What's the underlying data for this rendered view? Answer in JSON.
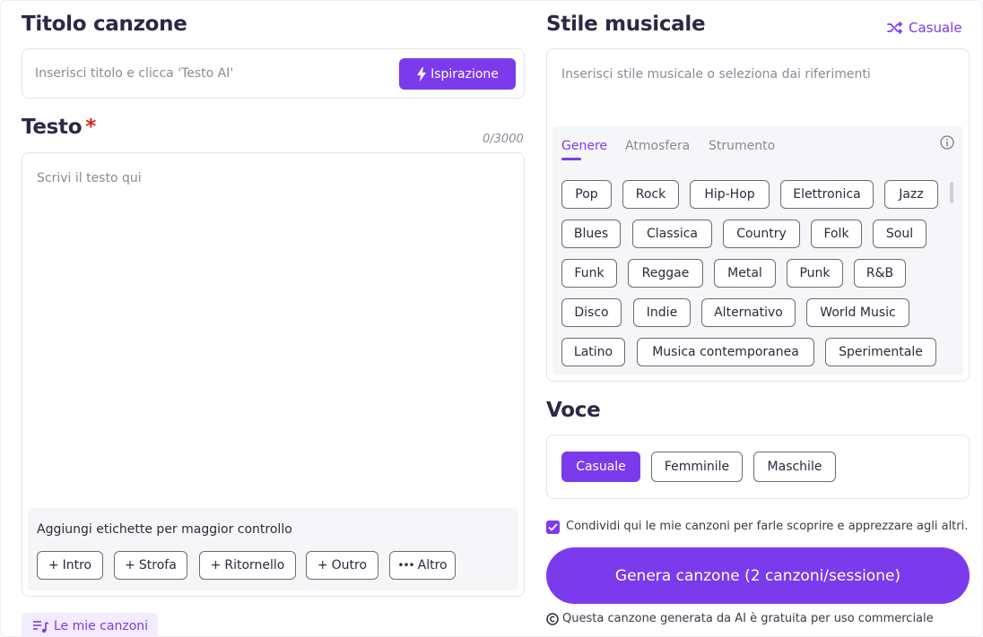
{
  "title_section": {
    "heading": "Titolo canzone",
    "input_placeholder": "Inserisci titolo e clicca 'Testo AI'",
    "inspiration_label": "Ispirazione"
  },
  "lyrics_section": {
    "heading": "Testo",
    "required_mark": "*",
    "counter": "0/3000",
    "textarea_placeholder": "Scrivi il testo qui",
    "tags_hint": "Aggiungi etichette per maggior controllo",
    "tags": [
      {
        "label": "Intro"
      },
      {
        "label": "Strofa"
      },
      {
        "label": "Ritornello"
      },
      {
        "label": "Outro"
      },
      {
        "label": "Altro"
      }
    ]
  },
  "my_songs_label": "Le mie canzoni",
  "style_section": {
    "heading": "Stile musicale",
    "random_label": "Casuale",
    "input_placeholder": "Inserisci stile musicale o seleziona dai riferimenti",
    "tabs": [
      {
        "label": "Genere",
        "active": true
      },
      {
        "label": "Atmosfera",
        "active": false
      },
      {
        "label": "Strumento",
        "active": false
      }
    ],
    "genres": [
      "Pop",
      "Rock",
      "Hip-Hop",
      "Elettronica",
      "Jazz",
      "Blues",
      "Classica",
      "Country",
      "Folk",
      "Soul",
      "Funk",
      "Reggae",
      "Metal",
      "Punk",
      "R&B",
      "Disco",
      "Indie",
      "Alternativo",
      "World Music",
      "Latino",
      "Musica contemporanea",
      "Sperimentale"
    ]
  },
  "voice_section": {
    "heading": "Voce",
    "options": [
      {
        "label": "Casuale",
        "selected": true
      },
      {
        "label": "Femminile",
        "selected": false
      },
      {
        "label": "Maschile",
        "selected": false
      }
    ]
  },
  "share": {
    "checked": true,
    "label": "Condividi qui le mie canzoni per farle scoprire e apprezzare agli altri."
  },
  "generate_label": "Genera canzone (2 canzoni/sessione)",
  "footer_note": "Questa canzone generata da AI è gratuita per uso commerciale",
  "colors": {
    "accent": "#7c3aed",
    "text": "#2b2a45",
    "placeholder": "#8a8a96",
    "required": "#e02424"
  }
}
